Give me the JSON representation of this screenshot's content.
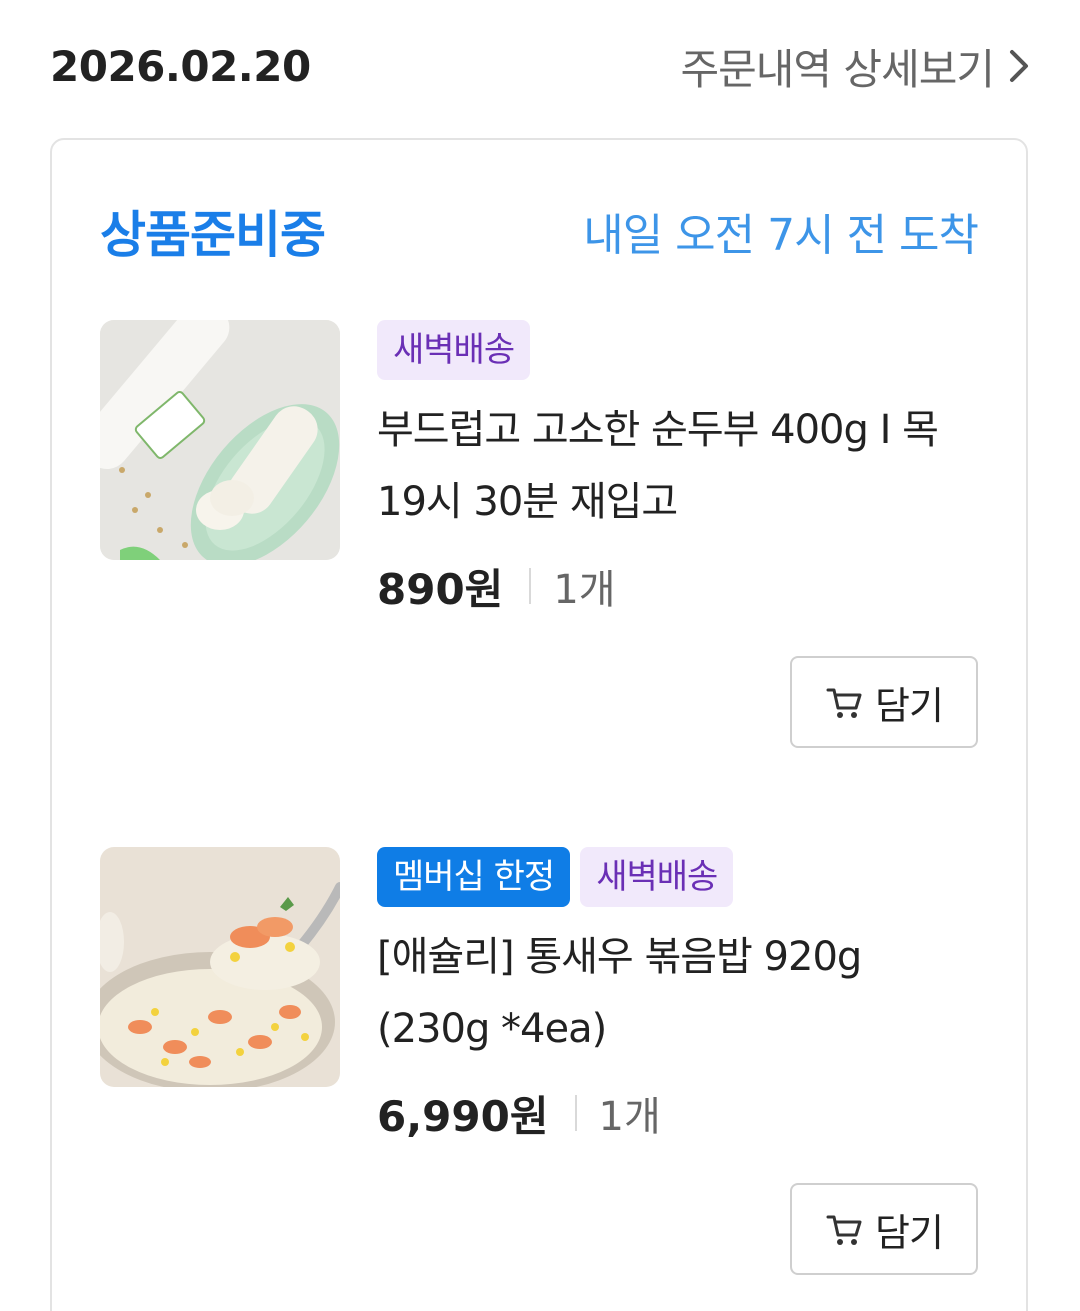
{
  "header": {
    "order_date": "2026.02.20",
    "detail_link_label": "주문내역 상세보기",
    "detail_icon": "chevron-right-icon"
  },
  "order": {
    "status": "상품준비중",
    "delivery_eta": "내일 오전 7시 전 도착",
    "colors": {
      "status": "#1a7ee8",
      "eta": "#3d95e8",
      "dawn_badge_bg": "#f1e9fb",
      "dawn_badge_text": "#6a2fb5",
      "member_badge_bg": "#0f7de6"
    },
    "items": [
      {
        "badges": [
          "새벽배송"
        ],
        "name": "부드럽고 고소한 순두부 400g I 목 19시 30분 재입고",
        "price": "890원",
        "quantity": "1개",
        "cart_button_label": "담기",
        "cart_icon": "cart-icon",
        "image_alt": "tofu-product-image"
      },
      {
        "badges": [
          "멤버십 한정",
          "새벽배송"
        ],
        "name": "[애슐리] 통새우 볶음밥 920g (230g *4ea)",
        "price": "6,990원",
        "quantity": "1개",
        "cart_button_label": "담기",
        "cart_icon": "cart-icon",
        "image_alt": "shrimp-fried-rice-image"
      }
    ]
  }
}
